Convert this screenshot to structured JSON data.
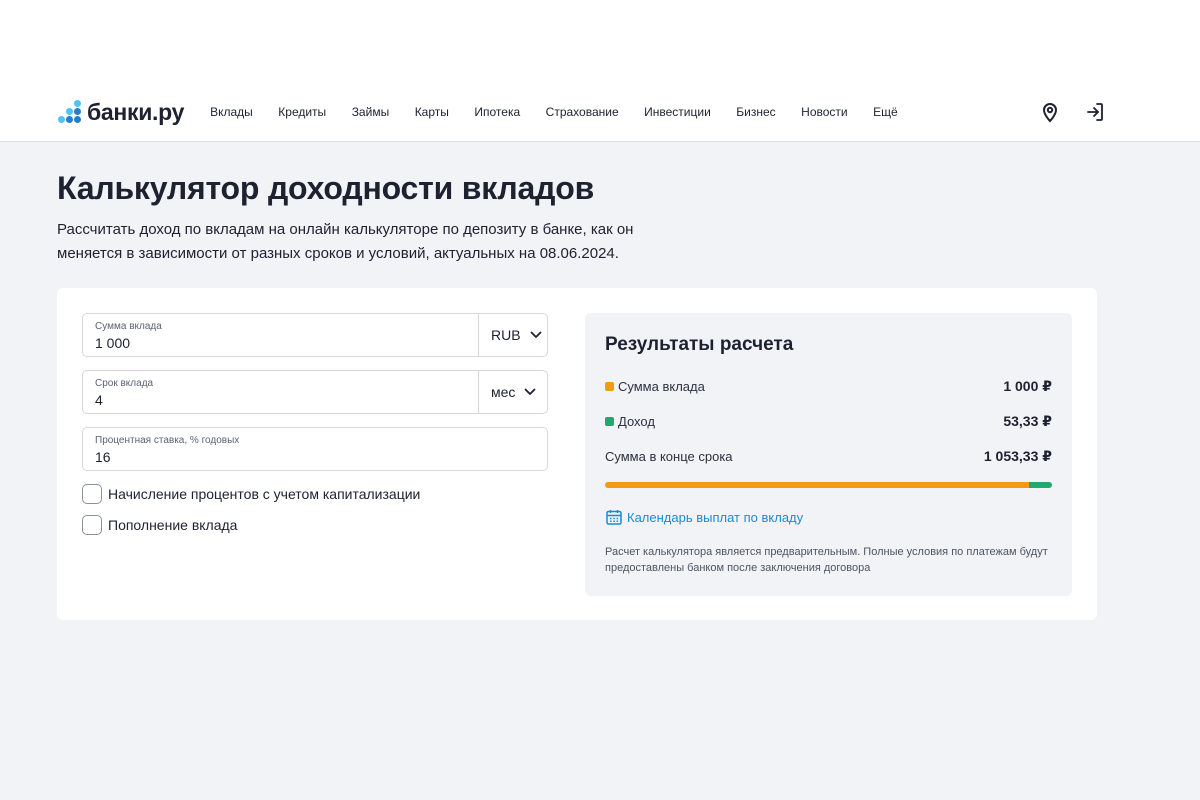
{
  "header": {
    "logo_text": "банки.ру",
    "nav": [
      "Вклады",
      "Кредиты",
      "Займы",
      "Карты",
      "Ипотека",
      "Страхование",
      "Инвестиции",
      "Бизнес",
      "Новости",
      "Ещё"
    ],
    "icons": [
      "location-pin-icon",
      "login-icon"
    ]
  },
  "page": {
    "title": "Калькулятор доходности вкладов",
    "description": "Рассчитать доход по вкладам на онлайн калькуляторе по депозиту в банке, как он меняется в зависимости от разных сроков и условий, актуальных на 08.06.2024."
  },
  "form": {
    "amount": {
      "label": "Сумма вклада",
      "value": "1 000",
      "currency": "RUB"
    },
    "term": {
      "label": "Срок вклада",
      "value": "4",
      "unit": "мес"
    },
    "rate": {
      "label": "Процентная ставка, % годовых",
      "value": "16"
    },
    "capitalization": {
      "label": "Начисление процентов с учетом капитализации",
      "checked": false
    },
    "replenishment": {
      "label": "Пополнение вклада",
      "checked": false
    }
  },
  "results": {
    "title": "Результаты расчета",
    "deposit": {
      "label": "Сумма вклада",
      "value": "1 000 ₽",
      "color": "#f39c12"
    },
    "income": {
      "label": "Доход",
      "value": "53,33 ₽",
      "color": "#21a86c"
    },
    "total": {
      "label": "Сумма в конце срока",
      "value": "1 053,33 ₽"
    },
    "bar_deposit_amount": 1000,
    "bar_income_amount": 53.33,
    "calendar_link": "Календарь выплат по вкладу",
    "note": "Расчет калькулятора является предварительным. Полные условия по платежам будут предоставлены банком после заключения договора"
  },
  "colors": {
    "accent_blue": "#1a8ad4",
    "logo_blue_dark": "#1f7fd1",
    "logo_blue_light": "#4fc3f7",
    "text_dark": "#1d2130",
    "background": "#f2f3f7"
  }
}
